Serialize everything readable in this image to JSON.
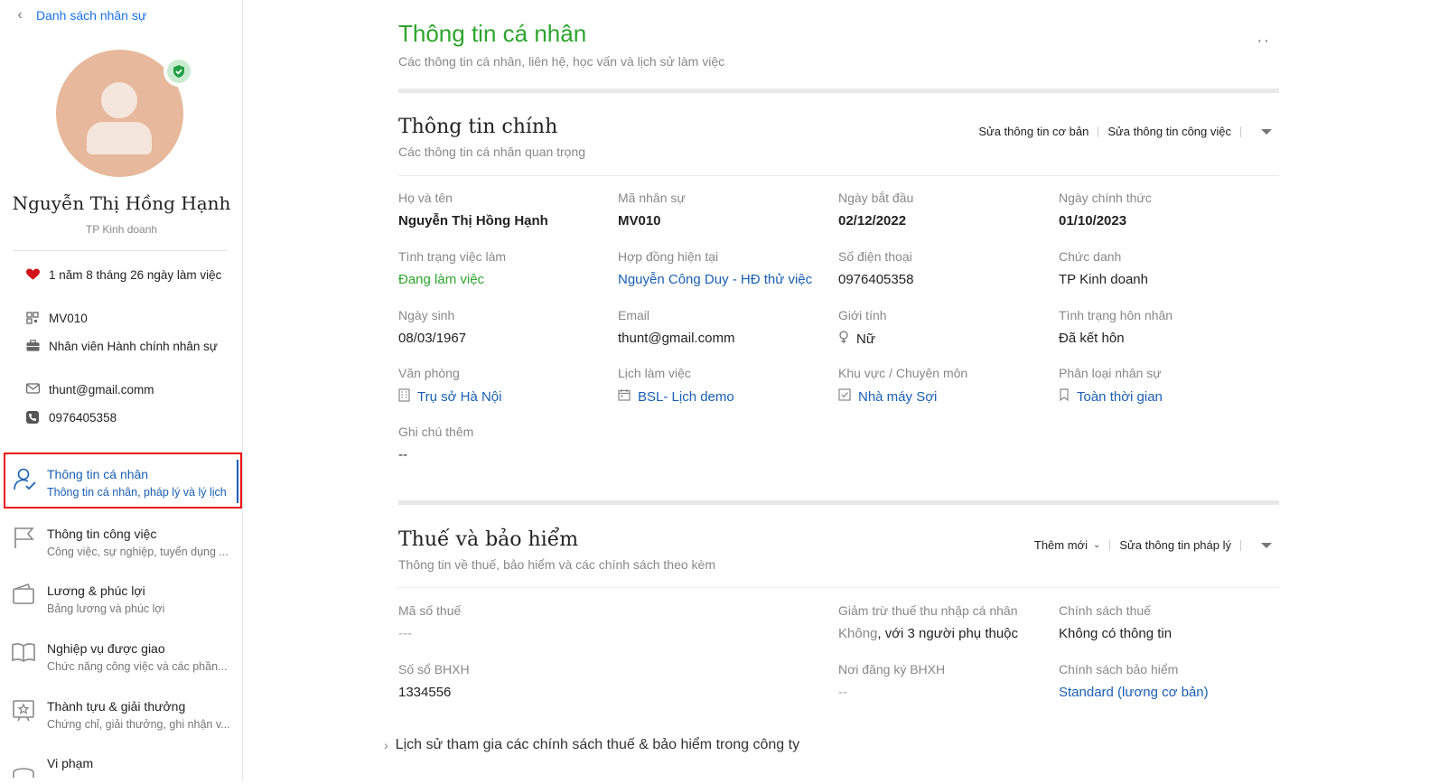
{
  "sidebar": {
    "back_label": "Danh sách nhân sự",
    "name": "Nguyễn Thị Hồng Hạnh",
    "title": "TP Kinh doanh",
    "info": {
      "tenure": "1 năm 8 tháng 26 ngày làm việc",
      "code": "MV010",
      "position": "Nhân viên Hành chính nhân sự",
      "email": "thunt@gmail.comm",
      "phone": "0976405358"
    },
    "menu": [
      {
        "title": "Thông tin cá nhân",
        "subtitle": "Thông tin cá nhân, pháp lý và lý lịch"
      },
      {
        "title": "Thông tin công việc",
        "subtitle": "Công việc, sự nghiệp, tuyển dụng ..."
      },
      {
        "title": "Lương & phúc lợi",
        "subtitle": "Bảng lương và phúc lợi"
      },
      {
        "title": "Nghiệp vụ được giao",
        "subtitle": "Chức năng công việc và các phần..."
      },
      {
        "title": "Thành tựu & giải thưởng",
        "subtitle": "Chứng chỉ, giải thưởng, ghi nhận v..."
      },
      {
        "title": "Vi phạm",
        "subtitle": ""
      }
    ]
  },
  "header": {
    "title": "Thông tin cá nhân",
    "subtitle": "Các thông tin cá nhân, liên hệ, học vấn và lịch sử làm việc",
    "more": "··"
  },
  "main_info": {
    "title": "Thông tin chính",
    "subtitle": "Các thông tin cá nhân quan trọng",
    "action_basic": "Sửa thông tin cơ bản",
    "action_work": "Sửa thông tin công việc",
    "fields": {
      "full_name": {
        "label": "Họ và tên",
        "value": "Nguyễn Thị Hồng Hạnh"
      },
      "staff_code": {
        "label": "Mã nhân sự",
        "value": "MV010"
      },
      "start_date": {
        "label": "Ngày bắt đầu",
        "value": "02/12/2022"
      },
      "official_date": {
        "label": "Ngày chính thức",
        "value": "01/10/2023"
      },
      "employment_status": {
        "label": "Tình trạng việc làm",
        "value": "Đang làm việc"
      },
      "contract": {
        "label": "Hợp đồng hiện tại",
        "value": "Nguyễn Công Duy - HĐ thử việc"
      },
      "phone": {
        "label": "Số điện thoại",
        "value": "0976405358"
      },
      "job_title": {
        "label": "Chức danh",
        "value": "TP Kinh doanh"
      },
      "birthday": {
        "label": "Ngày sinh",
        "value": "08/03/1967"
      },
      "email": {
        "label": "Email",
        "value": "thunt@gmail.comm"
      },
      "gender": {
        "label": "Giới tính",
        "value": "Nữ"
      },
      "marital": {
        "label": "Tình trạng hôn nhân",
        "value": "Đã kết hôn"
      },
      "office": {
        "label": "Văn phòng",
        "value": "Trụ sở Hà Nội"
      },
      "schedule": {
        "label": "Lịch làm việc",
        "value": "BSL- Lịch demo"
      },
      "area": {
        "label": "Khu vực / Chuyên môn",
        "value": "Nhà máy Sợi"
      },
      "category": {
        "label": "Phân loại nhân sự",
        "value": "Toàn thời gian"
      },
      "note": {
        "label": "Ghi chú thêm",
        "value": "--"
      }
    }
  },
  "tax": {
    "title": "Thuế và bảo hiểm",
    "subtitle": "Thông tin về thuế, bảo hiểm và các chính sách theo kèm",
    "action_add": "Thêm mới",
    "action_edit": "Sửa thông tin pháp lý",
    "fields": {
      "tax_code": {
        "label": "Mã số thuế",
        "value": "---"
      },
      "deduction": {
        "label": "Giảm trừ thuế thu nhập cá nhân",
        "value_prefix": "Không",
        "value_suffix": ", với 3 người phụ thuộc"
      },
      "tax_policy": {
        "label": "Chính sách thuế",
        "value": "Không có thông tin"
      },
      "social_book": {
        "label": "Số sổ BHXH",
        "value": "1334556"
      },
      "social_place": {
        "label": "Nơi đăng ký BHXH",
        "value": "--"
      },
      "insurance_policy": {
        "label": "Chính sách bảo hiểm",
        "value": "Standard (lương cơ bản)"
      }
    },
    "history": "Lịch sử tham gia các chính sách thuế & bảo hiểm trong công ty"
  }
}
